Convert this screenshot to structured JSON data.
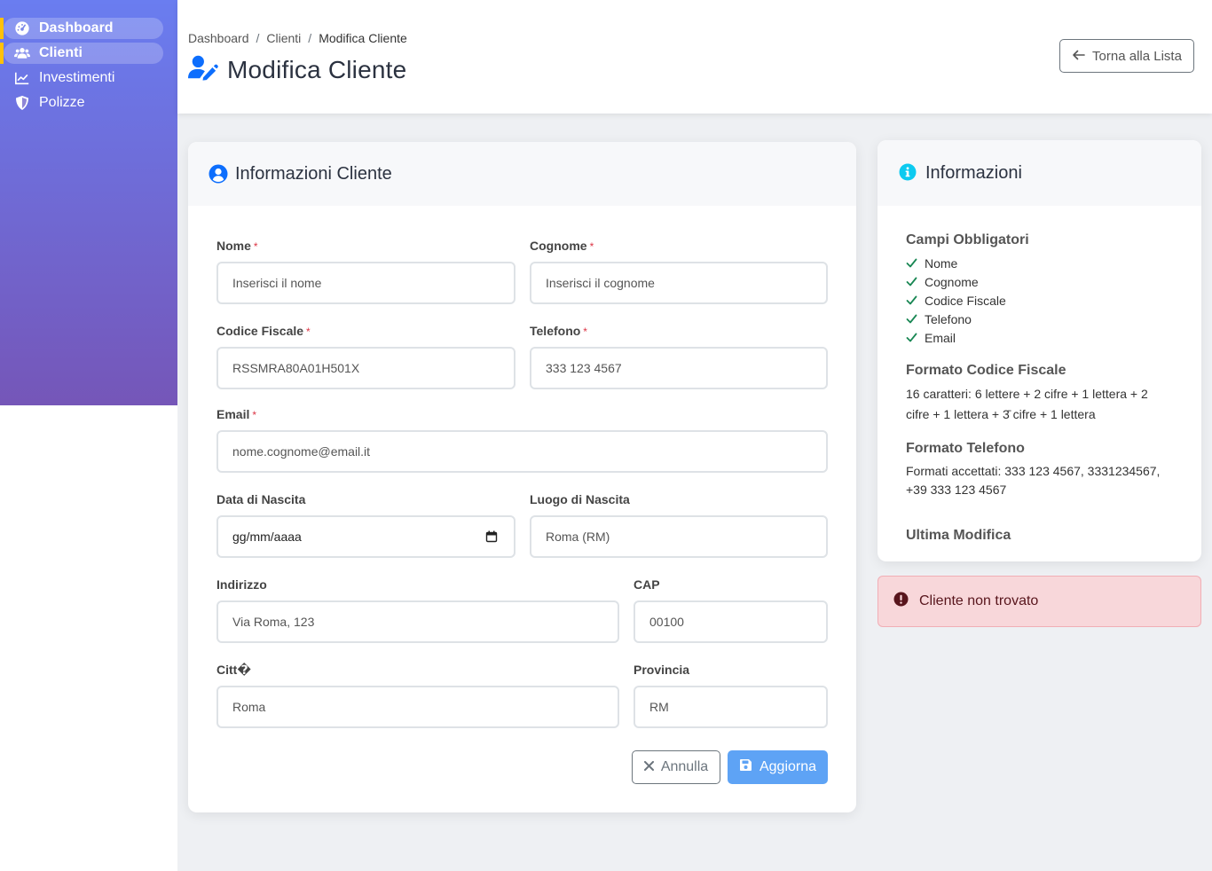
{
  "sidebar": {
    "items": [
      {
        "label": "Dashboard",
        "icon": "gauge-icon",
        "active": true
      },
      {
        "label": "Clienti",
        "icon": "users-icon",
        "active": true
      },
      {
        "label": "Investimenti",
        "icon": "chart-line-icon",
        "active": false
      },
      {
        "label": "Polizze",
        "icon": "shield-icon",
        "active": false
      }
    ]
  },
  "header": {
    "breadcrumb": [
      "Dashboard",
      "Clienti",
      "Modifica Cliente"
    ],
    "breadcrumb_sep": "/",
    "title": "Modifica Cliente",
    "back_button": "Torna alla Lista"
  },
  "form": {
    "title": "Informazioni Cliente",
    "required_mark": "*",
    "nome": {
      "label": "Nome",
      "placeholder": "Inserisci il nome",
      "value": ""
    },
    "cognome": {
      "label": "Cognome",
      "placeholder": "Inserisci il cognome",
      "value": ""
    },
    "codice_fiscale": {
      "label": "Codice Fiscale",
      "placeholder": "RSSMRA80A01H501X",
      "value": ""
    },
    "telefono": {
      "label": "Telefono",
      "placeholder": "333 123 4567",
      "value": ""
    },
    "email": {
      "label": "Email",
      "placeholder": "nome.cognome@email.it",
      "value": ""
    },
    "data_nascita": {
      "label": "Data di Nascita",
      "placeholder": "gg/mm/aaaa"
    },
    "luogo_nascita": {
      "label": "Luogo di Nascita",
      "placeholder": "Roma (RM)"
    },
    "indirizzo": {
      "label": "Indirizzo",
      "placeholder": "Via Roma, 123"
    },
    "cap": {
      "label": "CAP",
      "placeholder": "00100"
    },
    "citta": {
      "label": "Citt�",
      "placeholder": "Roma"
    },
    "provincia": {
      "label": "Provincia",
      "placeholder": "RM"
    },
    "cancel_button": "Annulla",
    "save_button": "Aggiorna"
  },
  "info": {
    "title": "Informazioni",
    "required_title": "Campi Obbligatori",
    "required_fields": [
      "Nome",
      "Cognome",
      "Codice Fiscale",
      "Telefono",
      "Email"
    ],
    "cf_title": "Formato Codice Fiscale",
    "cf_text": "16 caratteri: 6 lettere + 2 cifre + 1 lettera + 2 cifre + 1 lettera + 3̄ cifre + 1 lettera",
    "tel_title": "Formato Telefono",
    "tel_text": "Formati accettati: 333 123 4567, 3331234567, +39 333 123 4567",
    "last_modified_title": "Ultima Modifica"
  },
  "alert": {
    "text": "Cliente non trovato"
  },
  "colors": {
    "accent": "#0d6efd",
    "sidebar_top": "#6a7df0",
    "sidebar_bottom": "#7556b8",
    "active_marker": "#ffc107",
    "info_icon": "#0dcaf0",
    "check": "#198754",
    "danger": "#dc3545",
    "save_button": "#5ea3f5"
  }
}
